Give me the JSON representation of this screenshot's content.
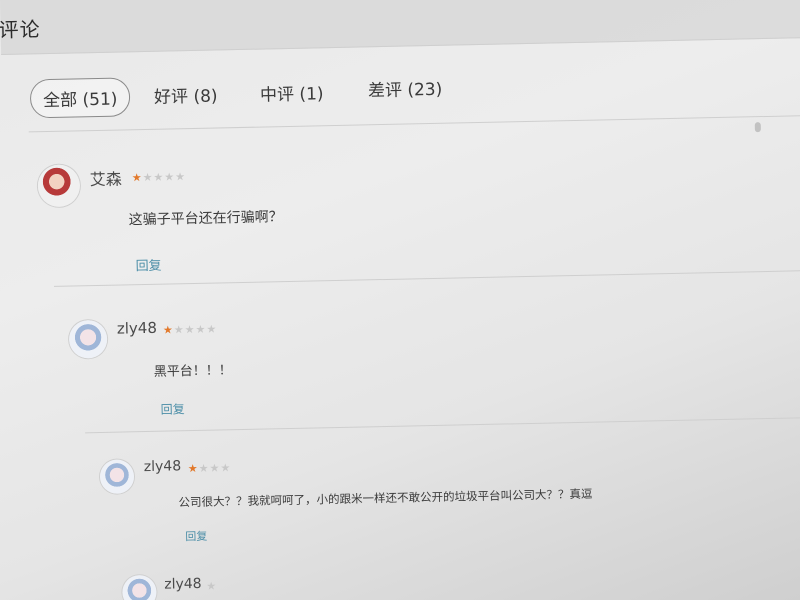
{
  "header": {
    "title": "评论"
  },
  "tabs": [
    {
      "label": "全部 (51)"
    },
    {
      "label": "好评 (8)"
    },
    {
      "label": "中评 (1)"
    },
    {
      "label": "差评 (23)"
    }
  ],
  "comments": [
    {
      "username": "艾森",
      "stars": {
        "filled": "★",
        "empty": "★★★★"
      },
      "text": "这骗子平台还在行骗啊？",
      "reply_label": "回复"
    },
    {
      "username": "zly48",
      "stars": {
        "filled": "★",
        "empty": "★★★★"
      },
      "text": "黑平台！！！",
      "reply_label": "回复"
    },
    {
      "username": "zly48",
      "stars": {
        "filled": "★",
        "empty": "★★★"
      },
      "text": "公司很大？？我就呵呵了，小的跟米一样还不敢公开的垃圾平台叫公司大？？真逗",
      "reply_label": "回复"
    },
    {
      "username": "zly48",
      "stars": {
        "filled": "",
        "empty": "★"
      }
    }
  ],
  "colors": {
    "accent_star": "#e2782a",
    "reply_link": "#4d8fa8"
  }
}
